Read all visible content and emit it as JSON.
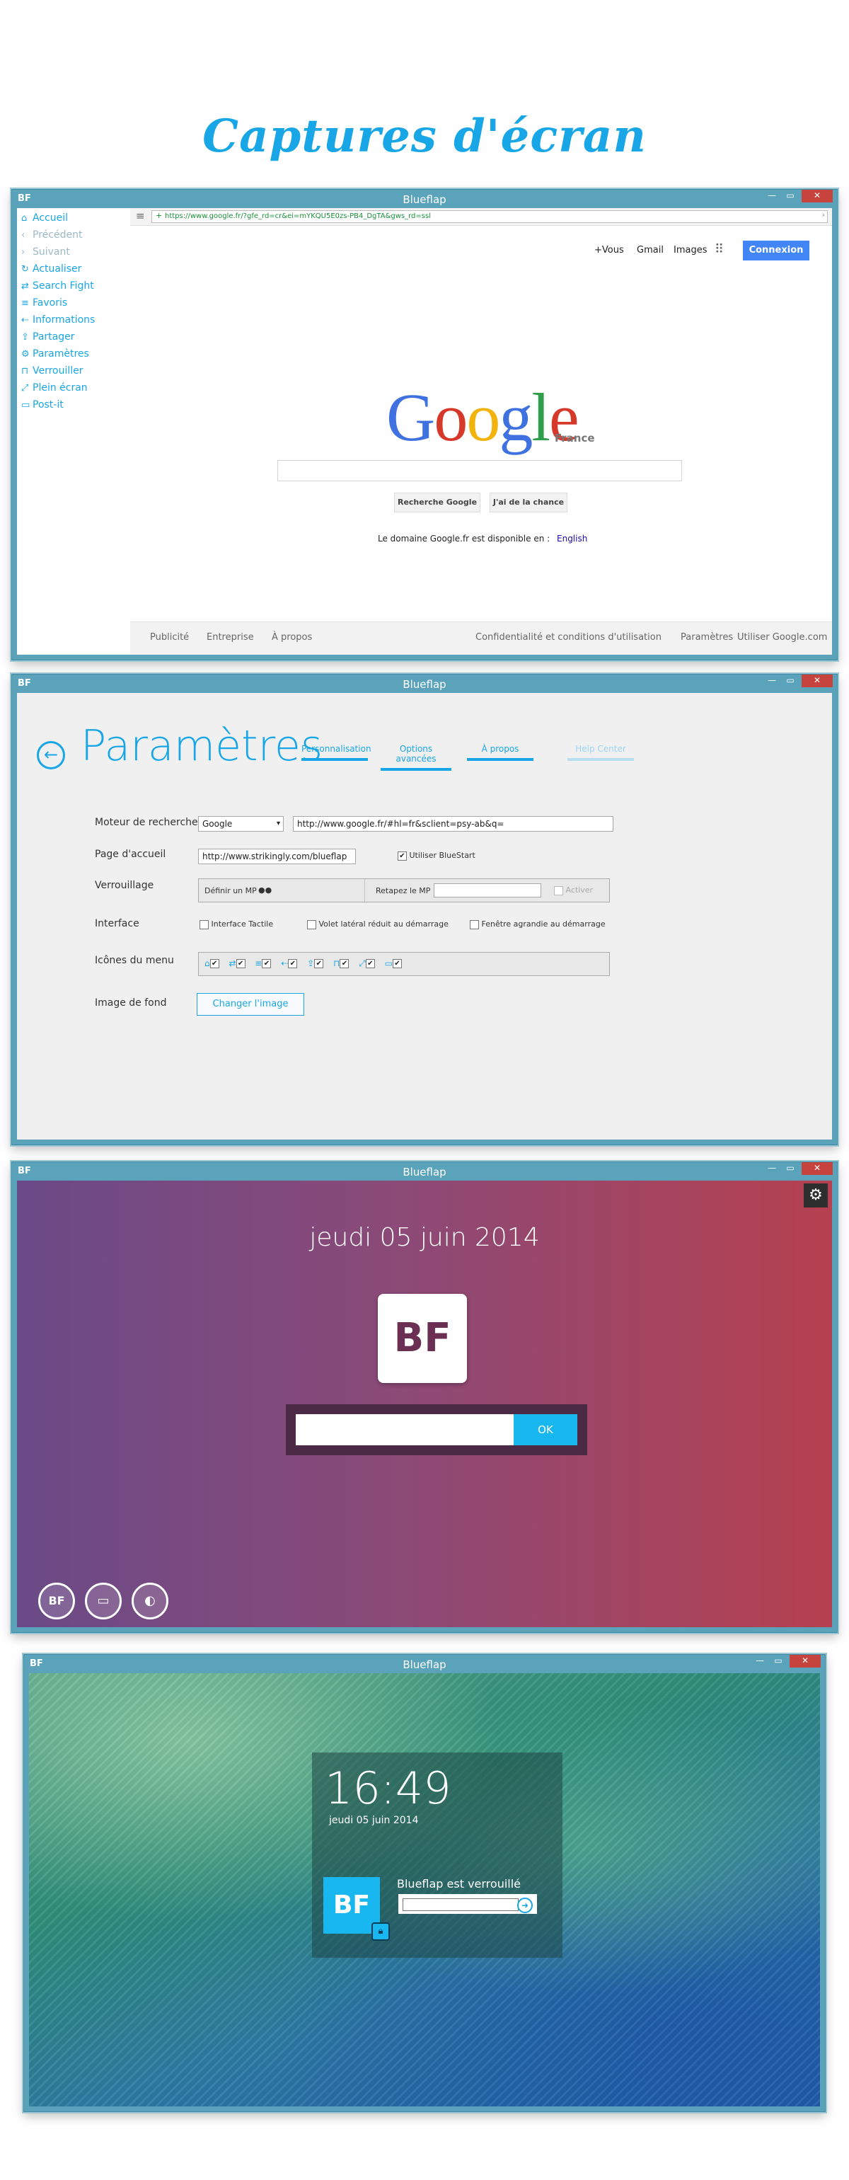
{
  "page": {
    "title": "Captures d'écran"
  },
  "windows": {
    "w1": {
      "title": "Blueflap",
      "logo": "BF",
      "sidebar": [
        {
          "label": "Accueil",
          "icon": "home-icon",
          "glyph": "⌂"
        },
        {
          "label": "Précédent",
          "icon": "back-icon",
          "glyph": "‹"
        },
        {
          "label": "Suivant",
          "icon": "forward-icon",
          "glyph": "›"
        },
        {
          "label": "Actualiser",
          "icon": "refresh-icon",
          "glyph": "↻"
        },
        {
          "label": "Search Fight",
          "icon": "search-fight-icon",
          "glyph": "⇄"
        },
        {
          "label": "Favoris",
          "icon": "favorites-icon",
          "glyph": "≡"
        },
        {
          "label": "Informations",
          "icon": "info-icon",
          "glyph": "⇠"
        },
        {
          "label": "Partager",
          "icon": "share-icon",
          "glyph": "⇪"
        },
        {
          "label": "Paramètres",
          "icon": "settings-icon",
          "glyph": "⚙"
        },
        {
          "label": "Verrouiller",
          "icon": "lock-icon",
          "glyph": "⊓"
        },
        {
          "label": "Plein écran",
          "icon": "fullscreen-icon",
          "glyph": "⤢"
        },
        {
          "label": "Post-it",
          "icon": "postit-icon",
          "glyph": "▭"
        }
      ],
      "url": "https://www.google.fr/?gfe_rd=cr&ei=mYKQU5E0zs-PB4_DgTA&gws_rd=ssl",
      "google": {
        "top_links": [
          "+Vous",
          "Gmail",
          "Images"
        ],
        "connexion": "Connexion",
        "logo": "Google",
        "country": "France",
        "btn_search": "Recherche Google",
        "btn_lucky": "J'ai de la chance",
        "domain_text": "Le domaine Google.fr est disponible en :",
        "domain_link": "English",
        "footer_left": [
          "Publicité",
          "Entreprise",
          "À propos"
        ],
        "footer_right": [
          "Confidentialité et conditions d'utilisation",
          "Paramètres",
          "Utiliser Google.com"
        ]
      }
    },
    "w2": {
      "title": "Blueflap",
      "heading": "Paramètres",
      "tabs": [
        "Personnalisation",
        "Options avancées",
        "À propos",
        "Help Center"
      ],
      "search_engine_label": "Moteur de recherche",
      "search_engine_value": "Google",
      "search_engine_url": "http://www.google.fr/#hl=fr&sclient=psy-ab&q=",
      "home_label": "Page d'accueil",
      "home_value": "http://www.strikingly.com/blueflap",
      "use_bluestart": "Utiliser BlueStart",
      "lock_label": "Verrouillage",
      "define_mp": "Définir un MP",
      "mp_dots": "●●",
      "retype_mp": "Retapez le MP",
      "activate": "Activer",
      "interface_label": "Interface",
      "interface_opts": [
        "Interface Tactile",
        "Volet latéral réduit au démarrage",
        "Fenêtre agrandie au démarrage"
      ],
      "menu_icons_label": "Icônes du menu",
      "menu_icon_glyphs": [
        "⌂",
        "⇄",
        "≡",
        "⇠",
        "⇪",
        "⊓",
        "⤢",
        "▭"
      ],
      "bg_label": "Image de fond",
      "change_image": "Changer l'image"
    },
    "w3": {
      "title": "Blueflap",
      "date": "jeudi 05 juin 2014",
      "ok": "OK",
      "logo": "BF"
    },
    "w4": {
      "title": "Blueflap",
      "time": "16:49",
      "date": "jeudi 05 juin 2014",
      "locked_text": "Blueflap est verrouillé",
      "logo": "BF"
    }
  }
}
